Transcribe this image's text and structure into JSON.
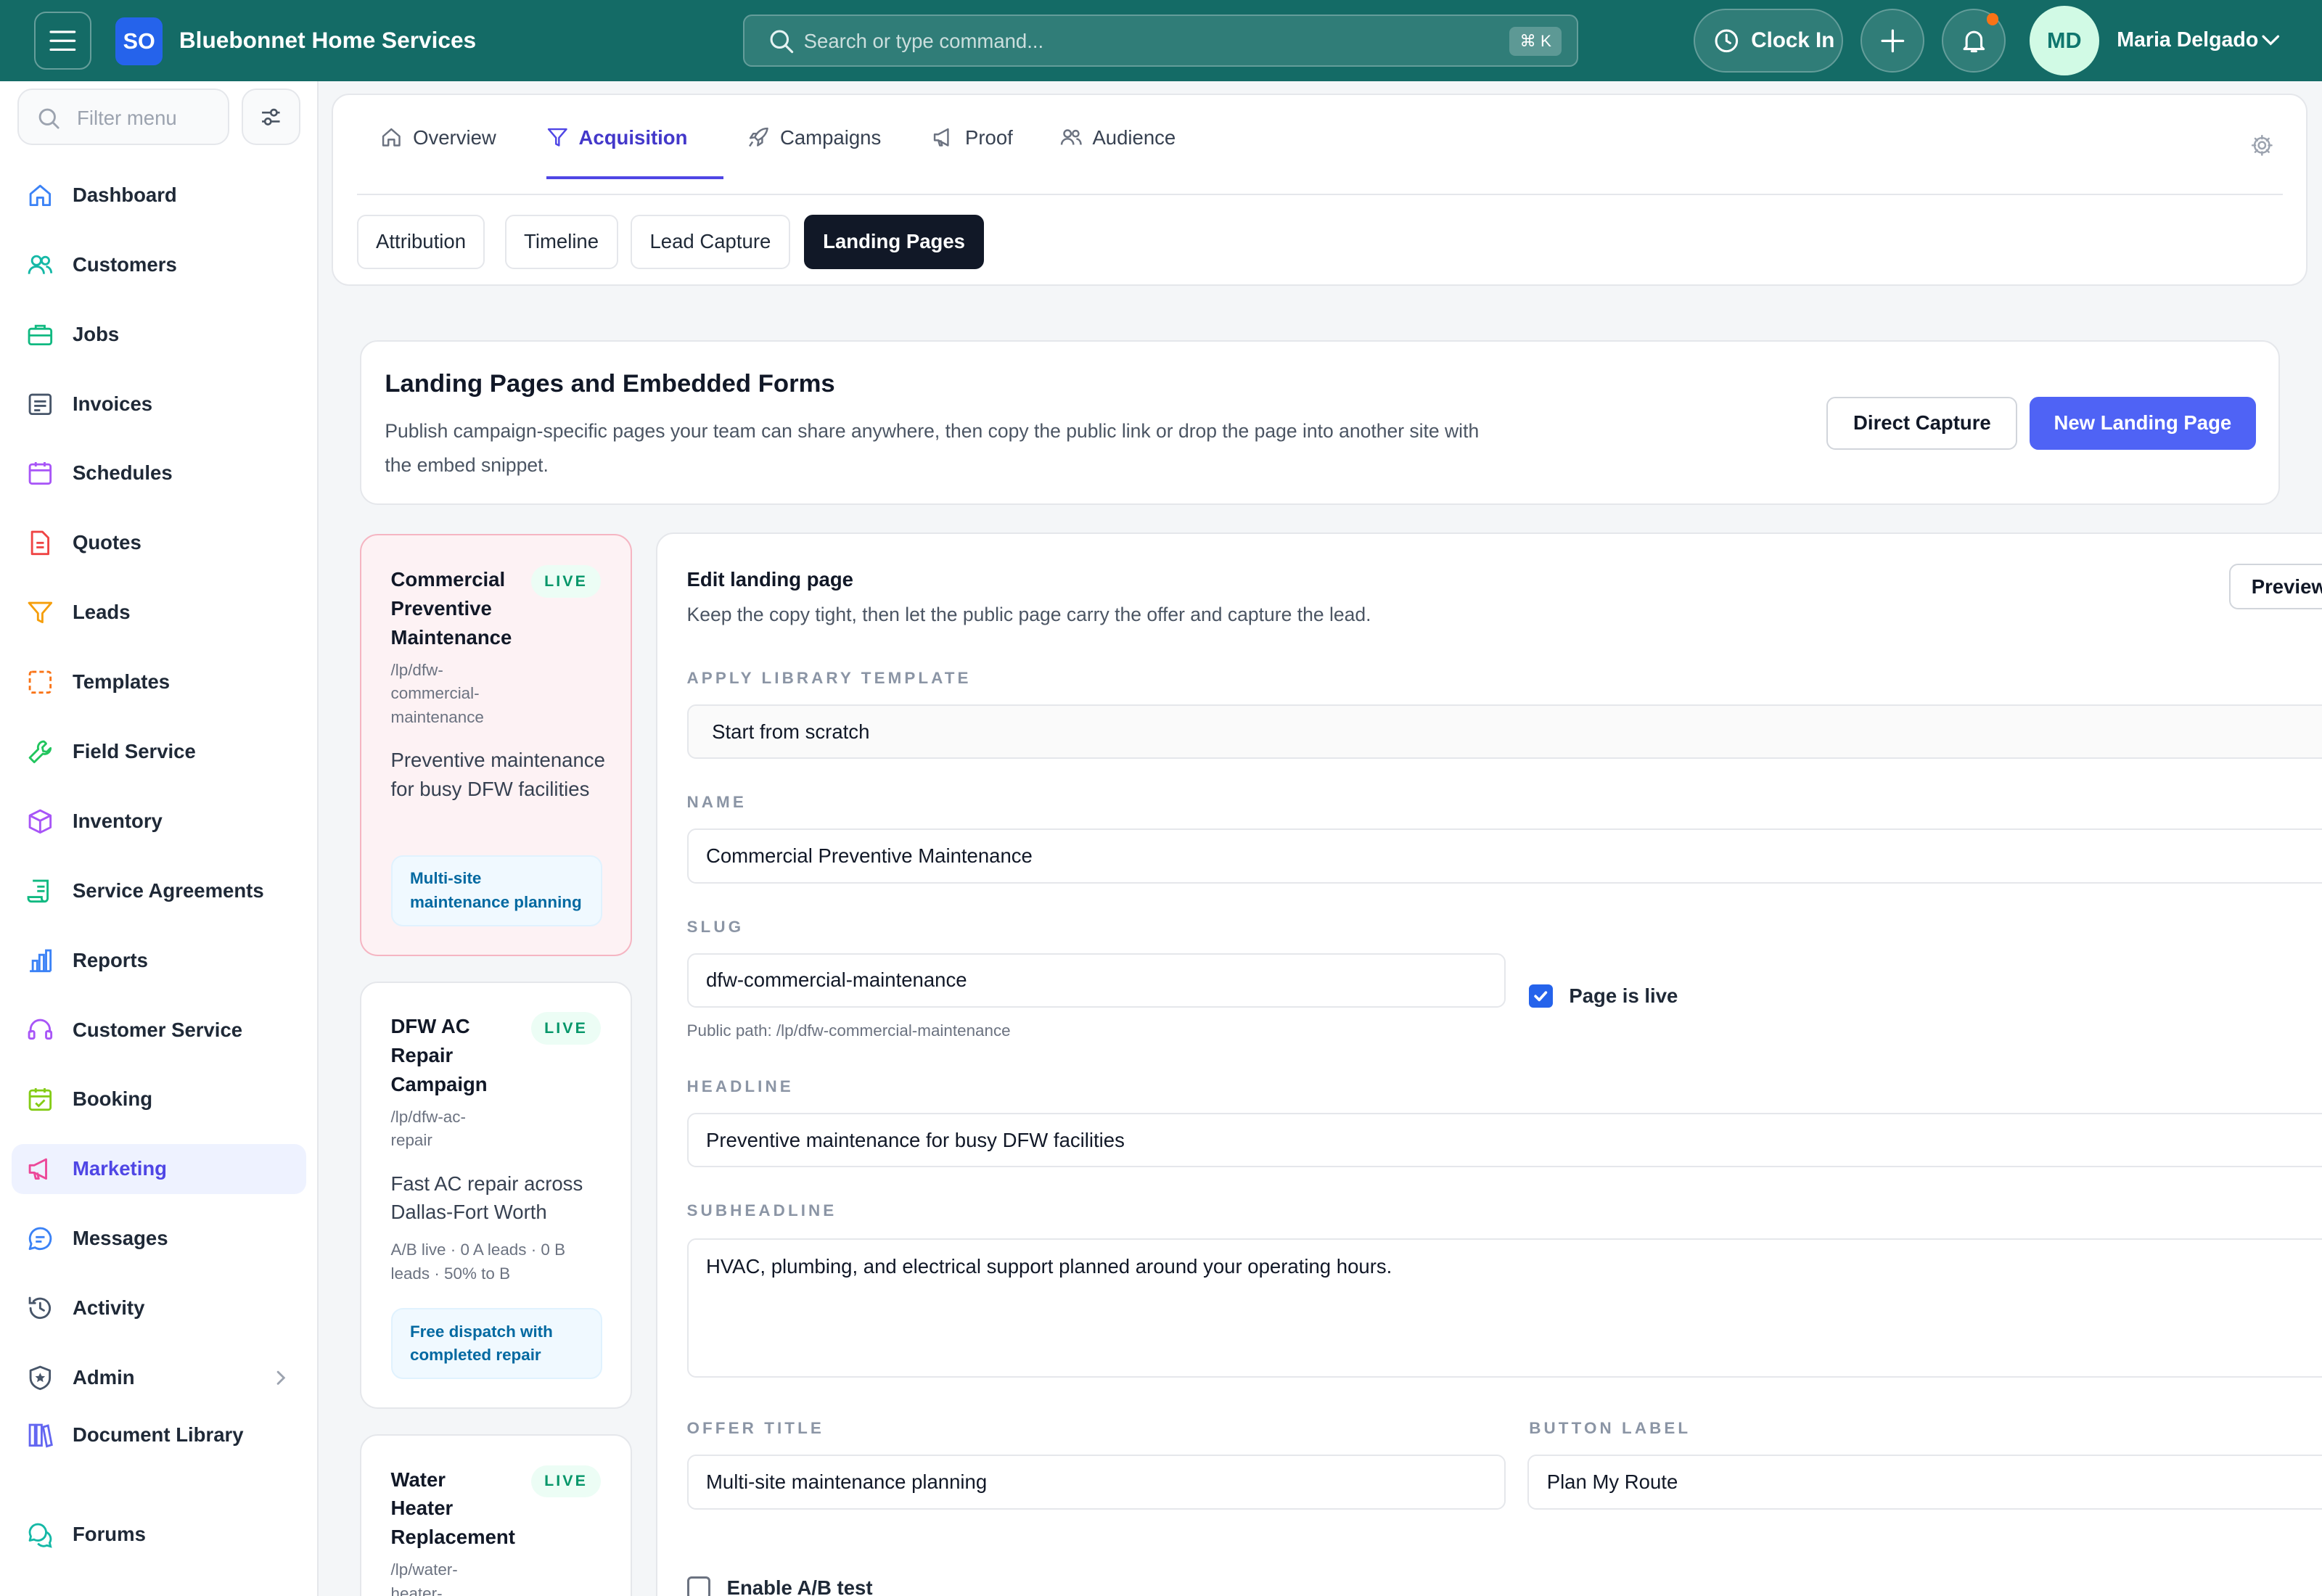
{
  "app": {
    "logo": "SO",
    "name": "Bluebonnet Home Services",
    "search_placeholder": "Search or type command...",
    "search_shortcut": "⌘ K",
    "clock_in_label": "Clock In",
    "user_initials": "MD",
    "user_name": "Maria Delgado"
  },
  "sidebar": {
    "filter_placeholder": "Filter menu",
    "items": [
      {
        "label": "Dashboard",
        "icon": "home-icon"
      },
      {
        "label": "Customers",
        "icon": "users-icon"
      },
      {
        "label": "Jobs",
        "icon": "briefcase-icon"
      },
      {
        "label": "Invoices",
        "icon": "invoice-icon"
      },
      {
        "label": "Schedules",
        "icon": "calendar-icon"
      },
      {
        "label": "Quotes",
        "icon": "file-icon"
      },
      {
        "label": "Leads",
        "icon": "funnel-icon"
      },
      {
        "label": "Templates",
        "icon": "template-icon"
      },
      {
        "label": "Field Service",
        "icon": "wrench-icon"
      },
      {
        "label": "Inventory",
        "icon": "box-icon"
      },
      {
        "label": "Service Agreements",
        "icon": "scroll-icon"
      },
      {
        "label": "Reports",
        "icon": "bar-chart-icon"
      },
      {
        "label": "Customer Service",
        "icon": "headset-icon"
      },
      {
        "label": "Booking",
        "icon": "calendar-check-icon"
      },
      {
        "label": "Marketing",
        "icon": "megaphone-icon",
        "active": true
      },
      {
        "label": "Messages",
        "icon": "chat-icon"
      },
      {
        "label": "Activity",
        "icon": "history-icon"
      },
      {
        "label": "Admin",
        "icon": "shield-icon"
      },
      {
        "label": "Document Library",
        "icon": "books-icon"
      },
      {
        "label": "Forums",
        "icon": "forum-icon"
      }
    ]
  },
  "tabs": [
    {
      "label": "Overview",
      "icon": "home-icon"
    },
    {
      "label": "Acquisition",
      "icon": "funnel-icon",
      "active": true
    },
    {
      "label": "Campaigns",
      "icon": "rocket-icon"
    },
    {
      "label": "Proof",
      "icon": "megaphone-icon"
    },
    {
      "label": "Audience",
      "icon": "users-icon"
    }
  ],
  "subtabs": [
    {
      "label": "Attribution"
    },
    {
      "label": "Timeline"
    },
    {
      "label": "Lead Capture"
    },
    {
      "label": "Landing Pages",
      "active": true
    }
  ],
  "header": {
    "title": "Landing Pages and Embedded Forms",
    "description": "Publish campaign-specific pages your team can share anywhere, then copy the public link or drop the page into another site with the embed snippet.",
    "direct_capture_label": "Direct Capture",
    "new_page_label": "New Landing Page"
  },
  "pages": [
    {
      "title": "Commercial Preventive Maintenance",
      "status": "LIVE",
      "slug": "/lp/dfw-commercial-maintenance",
      "headline": "Preventive maintenance for busy DFW facilities",
      "meta": "",
      "offer": "Multi-site maintenance planning",
      "selected": true
    },
    {
      "title": "DFW AC Repair Campaign",
      "status": "LIVE",
      "slug": "/lp/dfw-ac-repair",
      "headline": "Fast AC repair across Dallas-Fort Worth",
      "meta": "A/B live · 0 A leads · 0 B leads · 50% to B",
      "offer": "Free dispatch with completed repair",
      "selected": false
    },
    {
      "title": "Water Heater Replacement",
      "status": "LIVE",
      "slug": "/lp/water-heater-",
      "headline": "",
      "meta": "",
      "offer": "",
      "selected": false
    }
  ],
  "editor": {
    "title": "Edit landing page",
    "subtitle": "Keep the copy tight, then let the public page carry the offer and capture the lead.",
    "preview_label": "Preview",
    "template_label": "APPLY LIBRARY TEMPLATE",
    "template_value": "Start from scratch",
    "name_label": "NAME",
    "name_value": "Commercial Preventive Maintenance",
    "slug_label": "SLUG",
    "slug_value": "dfw-commercial-maintenance",
    "live_label": "Page is live",
    "live_checked": true,
    "public_path": "Public path: /lp/dfw-commercial-maintenance",
    "headline_label": "HEADLINE",
    "headline_value": "Preventive maintenance for busy DFW facilities",
    "subheadline_label": "SUBHEADLINE",
    "subheadline_value": "HVAC, plumbing, and electrical support planned around your operating hours.",
    "offer_label": "OFFER TITLE",
    "offer_value": "Multi-site maintenance planning",
    "button_label_label": "BUTTON LABEL",
    "button_label_value": "Plan My Route",
    "ab_label": "Enable A/B test",
    "ab_checked": false
  },
  "colors": {
    "topbar": "#146b66",
    "primary": "#4f63f5",
    "active_nav": "#4f46e5",
    "live_badge": "#059669"
  }
}
